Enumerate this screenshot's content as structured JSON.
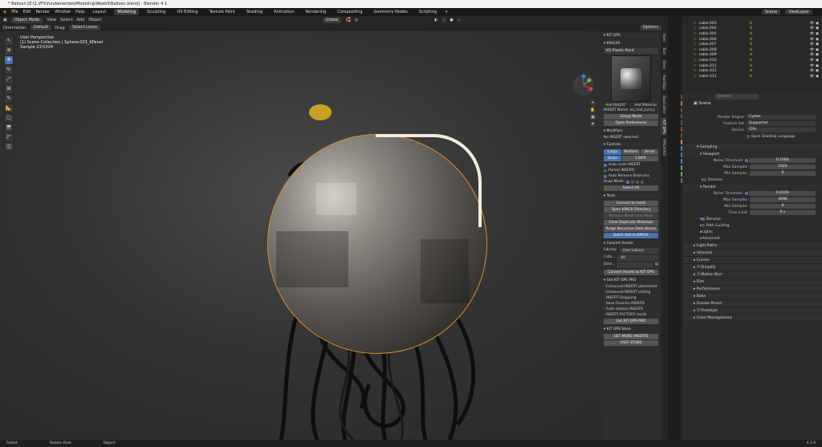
{
  "window": {
    "title": "* Balloon [E:\\1.VFX\\fundamentals\\Modeling\\Week9\\Balloon.blend] - Blender 4.1"
  },
  "menu": [
    "File",
    "Edit",
    "Render",
    "Window",
    "Help"
  ],
  "workspaces": [
    {
      "label": "Layout"
    },
    {
      "label": "Modeling",
      "active": true
    },
    {
      "label": "Sculpting"
    },
    {
      "label": "UV Editing"
    },
    {
      "label": "Texture Paint"
    },
    {
      "label": "Shading"
    },
    {
      "label": "Animation"
    },
    {
      "label": "Rendering"
    },
    {
      "label": "Compositing"
    },
    {
      "label": "Geometry Nodes"
    },
    {
      "label": "Scripting"
    }
  ],
  "header": {
    "mode": "Object Mode",
    "view": "View",
    "select": "Select",
    "add": "Add",
    "object": "Object",
    "orientation_label": "Orientation:",
    "orientation": "Default",
    "drag_label": "Drag:",
    "drag": "Select Lasso",
    "transform": "Global",
    "options": "Options",
    "scene": "Scene",
    "viewlayer": "ViewLayer"
  },
  "viewport": {
    "line1": "User Perspective",
    "line2": "(1) Scene Collection | Sphere.003_KPanel",
    "line3": "Sample 23/1024"
  },
  "tools": [
    "select-icon",
    "cursor-icon",
    "move-icon",
    "rotate-icon",
    "scale-icon",
    "transform-icon",
    "annotate-icon",
    "measure-icon",
    "add-cube-icon",
    "extrude-icon",
    "shear-icon",
    "spin-icon"
  ],
  "kitops": {
    "title": "KIT OPS",
    "kpacks": "KPACKS",
    "pack": "KO-Plastic-Paint",
    "add_insert": "Add INSERT",
    "add_material": "Add Material",
    "insert_name": "INSERT Name: ko_mat_lumry",
    "group_mode": "Group Mode",
    "open_prefs": "Open Preferences",
    "modifiers": "Modifiers",
    "no_insert": "No INSERT selected.",
    "controls": "Controls",
    "sizes": [
      "Large",
      "Medium",
      "Small"
    ],
    "scale": "Scale",
    "scale_value": "1.00%",
    "checks": [
      {
        "label": "Auto scale INSERT",
        "on": true
      },
      {
        "label": "Parent INSERTs",
        "on": false
      },
      {
        "label": "Auto Remove Booleans",
        "on": true
      }
    ],
    "snap_label": "Snap Mode:",
    "select_all": "Select All",
    "tools_title": "Tools",
    "tool_buttons": [
      {
        "label": "Convert to mesh",
        "state": "normal"
      },
      {
        "label": "Open KPACK Directory",
        "state": "normal"
      },
      {
        "label": "Remove Wireframe Mods",
        "state": "dim"
      },
      {
        "label": "Clear Duplicate Materials",
        "state": "normal"
      },
      {
        "label": "Purge Recursive Data Blocks",
        "state": "normal"
      },
      {
        "label": "Batch Add to KPACK",
        "state": "blue"
      }
    ],
    "convert_title": "Convert Assets",
    "library_label": "Library:",
    "library": "User Library",
    "cata_label": "Cata...",
    "cata": "All",
    "dest_label": "Dest...",
    "convert_btn": "Convert Assets to KIT OPS",
    "pro_title": "Get KIT OPS PRO",
    "pro_features": [
      "- Enhanced INSERT placement",
      "- Enhanced INSERT editing",
      "- INSERT Snapping",
      "- Save Favorite INSERTs",
      "- Auto replace INSERTs",
      "- INSERT FACTORY mode"
    ],
    "pro_btn": "Get KIT OPS PRO",
    "store_title": "KIT OPS Store",
    "get_more": "GET MORE INSERTS",
    "visit_store": "VISIT STORE"
  },
  "side_tabs": [
    "Item",
    "Tool",
    "View",
    "HardOps",
    "BoxCutter",
    "KIT OPS",
    "MACHIN3"
  ],
  "outliner": {
    "items": [
      "cable.003",
      "cable.004",
      "cable.005",
      "cable.006",
      "cable.007",
      "cable.008",
      "cable.009",
      "cable.010",
      "cable.011",
      "cable.012",
      "cable.013"
    ]
  },
  "properties": {
    "scene_label": "Scene",
    "search_placeholder": "Search",
    "render_engine_label": "Render Engine",
    "render_engine": "Cycles",
    "feature_set_label": "Feature Set",
    "feature_set": "Supported",
    "device_label": "Device",
    "device": "CPU",
    "osl": "Open Shading Language",
    "sampling": "Sampling",
    "viewport": "Viewport",
    "vp_noise_label": "Noise Threshold",
    "vp_noise": "0.1000",
    "vp_max_label": "Max Samples",
    "vp_max": "1024",
    "vp_min_label": "Min Samples",
    "vp_min": "0",
    "denoise": "Denoise",
    "render": "Render",
    "r_noise_label": "Noise Threshold",
    "r_noise": "0.0100",
    "r_max_label": "Max Samples",
    "r_max": "4096",
    "r_min_label": "Min Samples",
    "r_min": "0",
    "r_time_label": "Time Limit",
    "r_time": "0 s",
    "sub_sections": [
      "Path Guiding",
      "Lights",
      "Advanced"
    ],
    "sections": [
      "Light Paths",
      "Volumes",
      "Curves",
      "Simplify",
      "Motion Blur",
      "Film",
      "Performance",
      "Bake",
      "Grease Pencil",
      "Freestyle",
      "Color Management"
    ]
  },
  "status": {
    "select": "Select",
    "rotate": "Rotate View",
    "object": "Object",
    "version": "4.1.0"
  }
}
